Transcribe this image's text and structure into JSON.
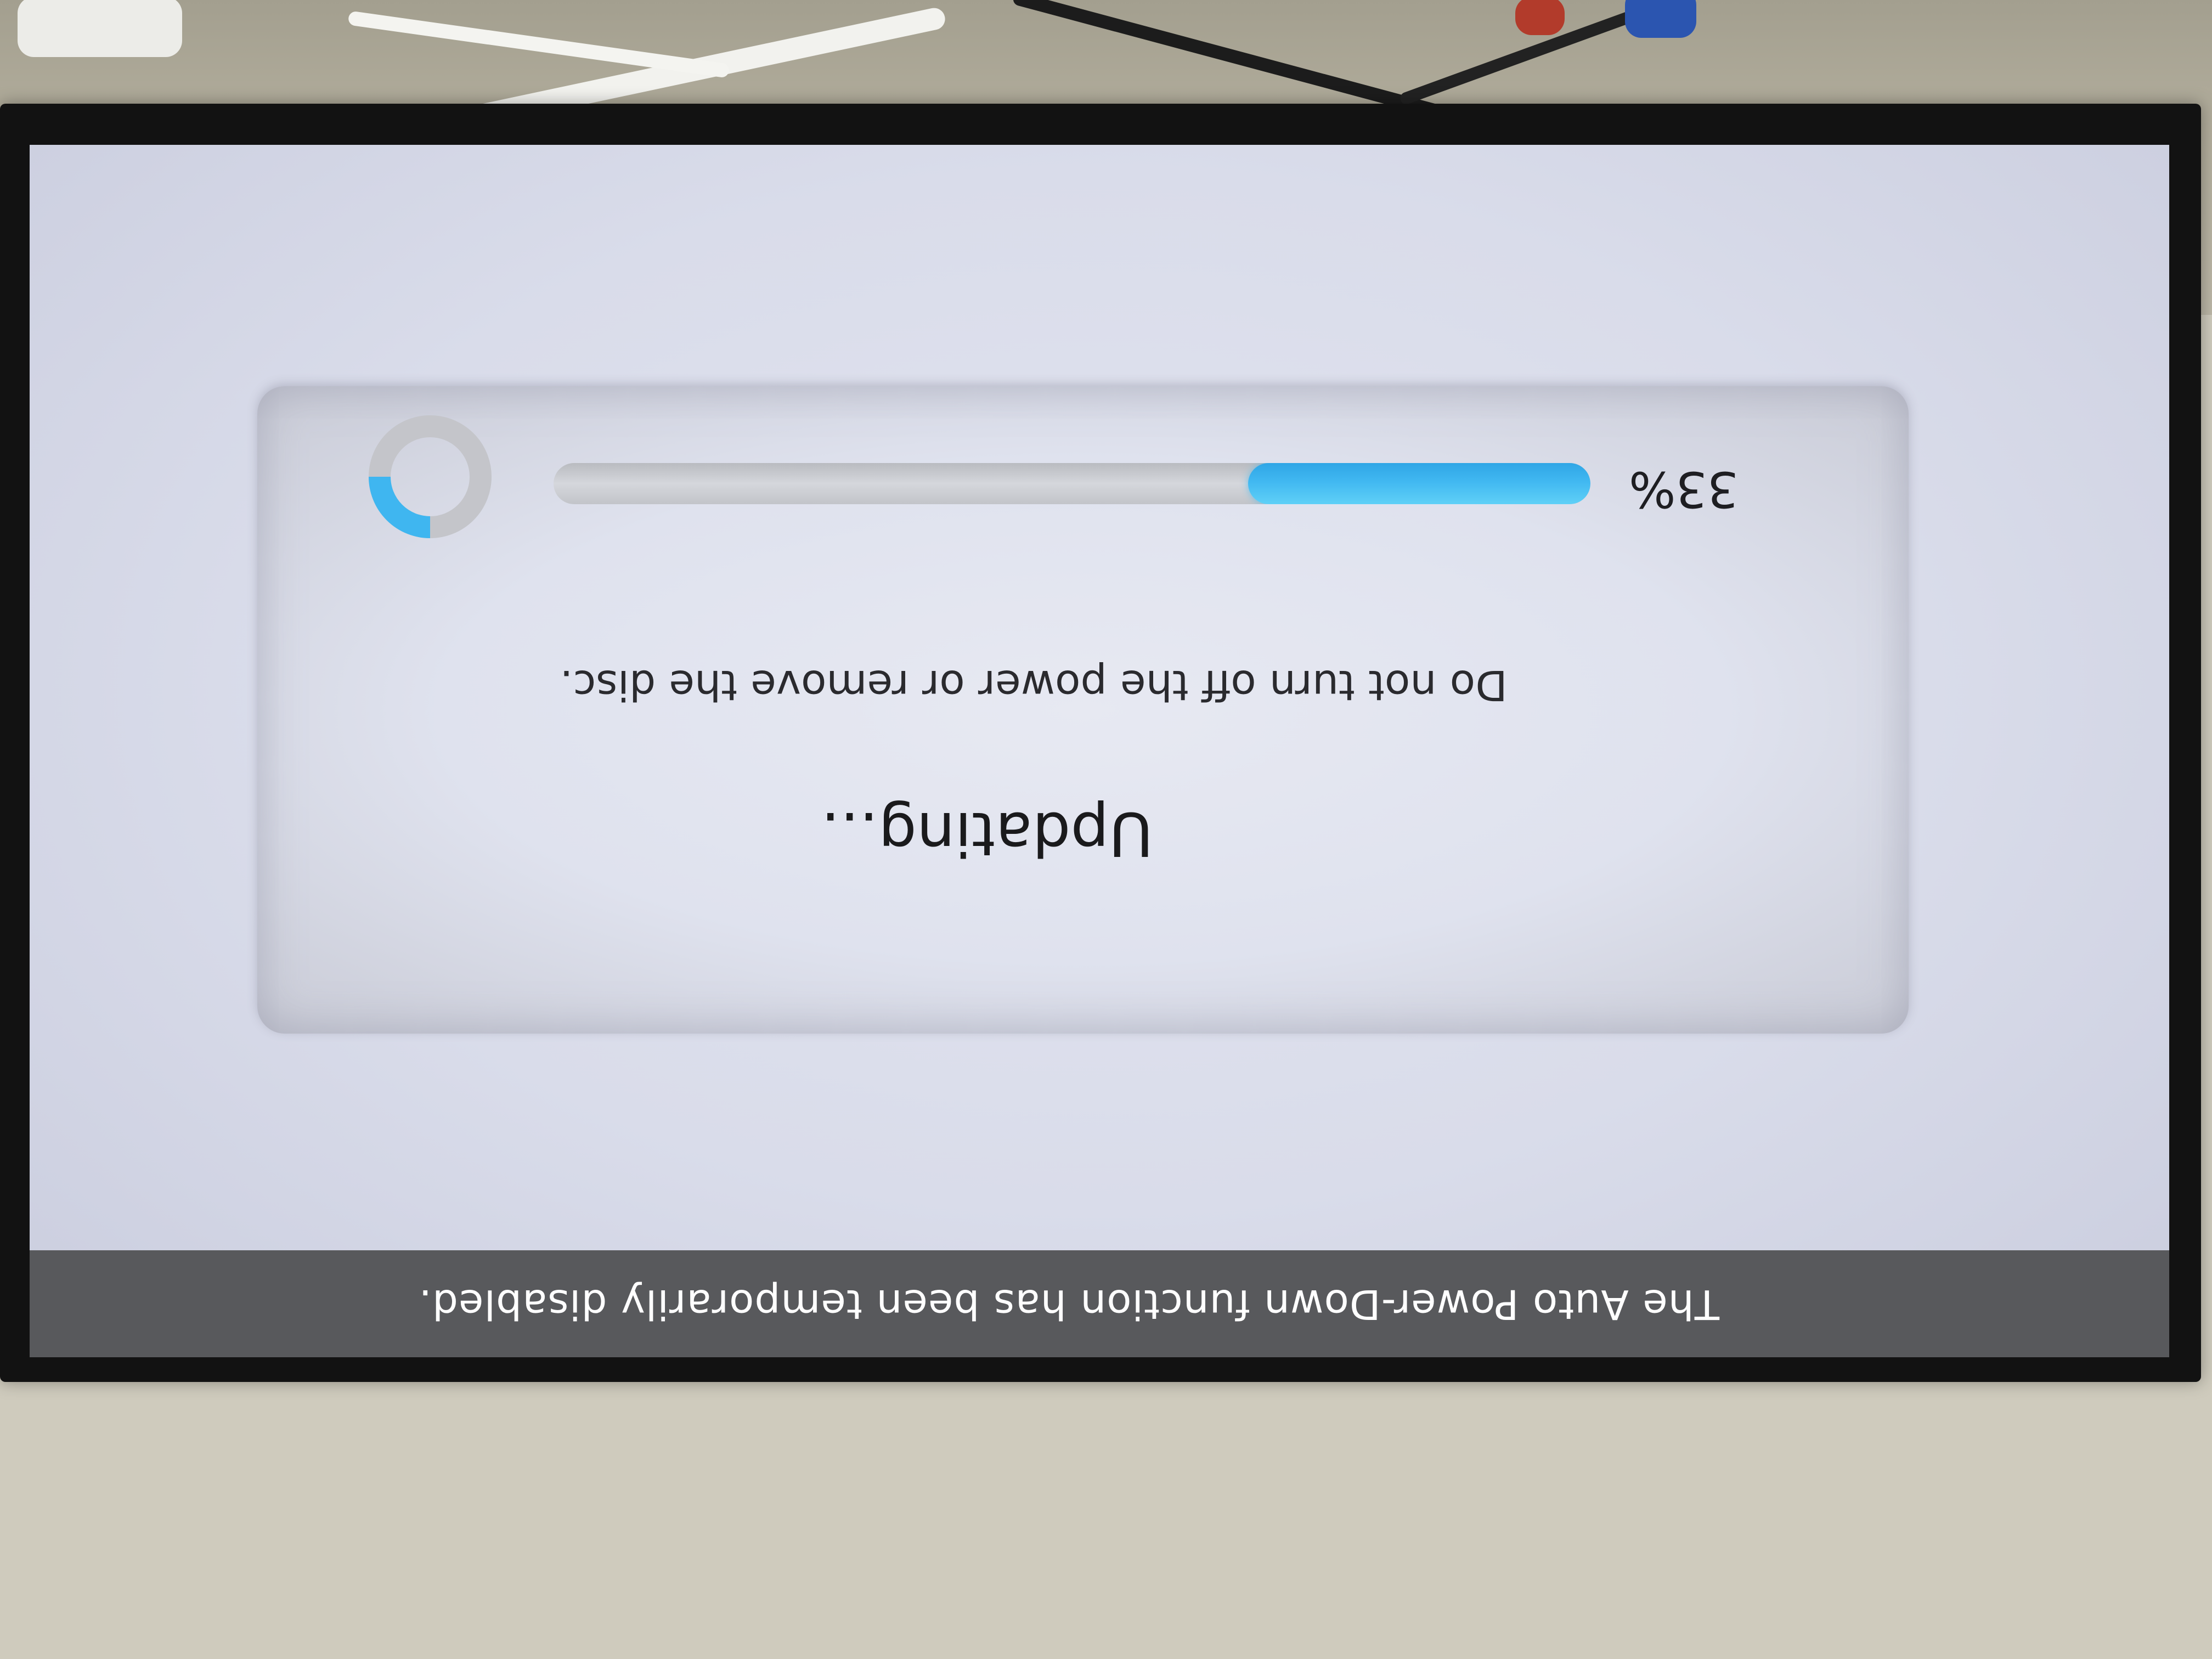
{
  "notice": {
    "text": "The Auto Power-Down function has been temporarily disabled."
  },
  "dialog": {
    "title": "Updating...",
    "warning": "Do not turn off the power or remove the disc.",
    "progress": {
      "percent_label": "33%",
      "fraction": 0.33
    }
  },
  "colors": {
    "accent": "#3fb6f0",
    "notice_bar": "#58595c",
    "screen_bg": "#dcdfec"
  },
  "icons": {
    "spinner": "loading-spinner-icon"
  }
}
